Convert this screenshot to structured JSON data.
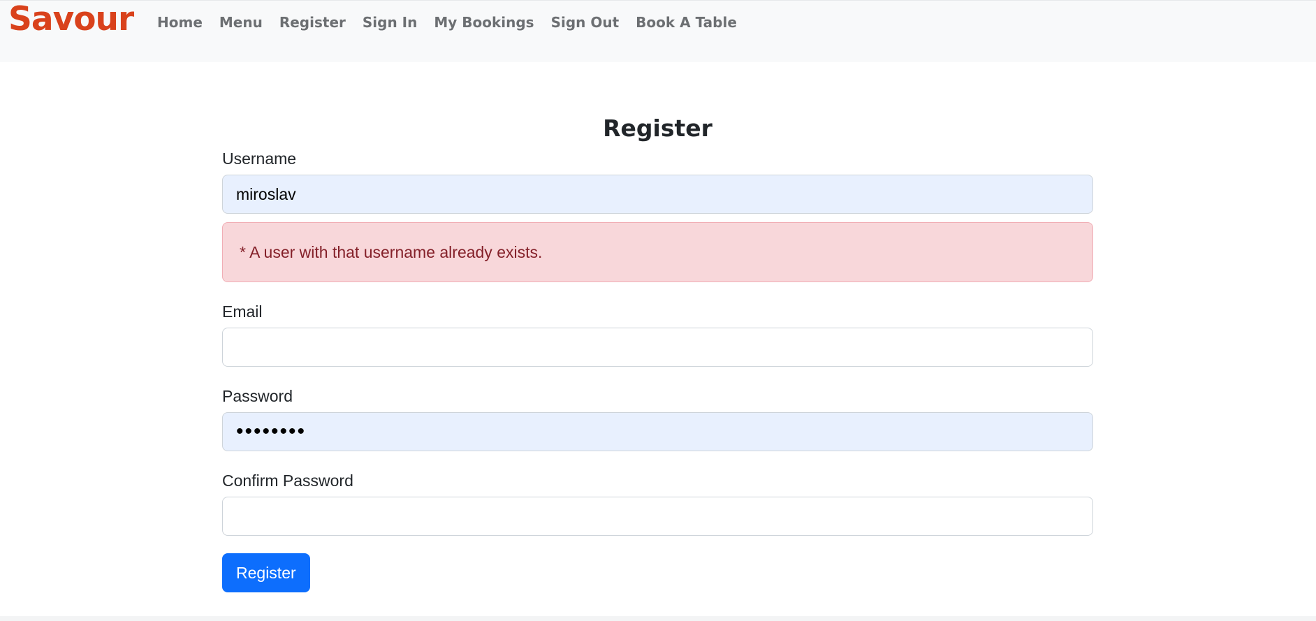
{
  "navbar": {
    "brand": "Savour",
    "links": [
      {
        "label": "Home"
      },
      {
        "label": "Menu"
      },
      {
        "label": "Register"
      },
      {
        "label": "Sign In"
      },
      {
        "label": "My Bookings"
      },
      {
        "label": "Sign Out"
      },
      {
        "label": "Book A Table"
      }
    ]
  },
  "form": {
    "title": "Register",
    "username": {
      "label": "Username",
      "value": "miroslav"
    },
    "error": "* A user with that username already exists.",
    "email": {
      "label": "Email",
      "value": ""
    },
    "password": {
      "label": "Password",
      "value": "••••••••"
    },
    "confirm_password": {
      "label": "Confirm Password",
      "value": ""
    },
    "submit_label": "Register"
  },
  "colors": {
    "brand": "#d9421c",
    "navbar_bg": "#f8f9fa",
    "primary": "#0d6efd",
    "error_bg": "#f8d7da",
    "error_text": "#842029",
    "autofill_bg": "#e8f0fe"
  }
}
